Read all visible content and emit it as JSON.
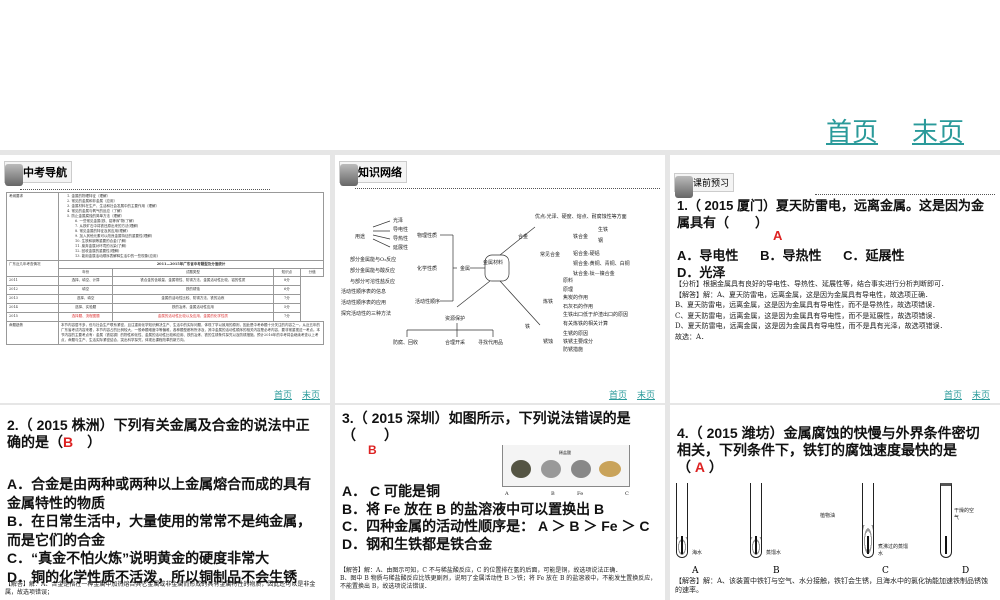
{
  "top_nav": {
    "first": "首页",
    "last": "末页"
  },
  "slide_nav": {
    "first": "首页",
    "last": "末页"
  },
  "slide1": {
    "header": "中考导航",
    "req_label": "考纲要求",
    "requirements": [
      "1. 金属的物理特征（理解）",
      "2. 常见的金属和非金属（应用）",
      "3. 金属材料在生产、生活和社会发展中的主要作用（理解）",
      "4. 常见的金属与氧气的反应（了解）",
      "5. 防止金属腐蚀的简单方法（理解）",
      "6. 一些常见金属(铁、铝等)矿物(了解)",
      "7. 从铁矿石中将铁还原出来的方法(理解)",
      "8. 常见金属的特征及其应用(理解)",
      "9. 加入其他元素可以改良金属特征的重要性(理解)",
      "10. 生铁和钢等重要的合金(了解)",
      "11. 废弃金属对环境的污染(了解)",
      "12. 回收金属的重要性(理解)",
      "13. 能用金属活动顺序表解释生活中的一些现象(应用)"
    ],
    "exam_label": "广东近几年考查情况",
    "table_title": "2011—2015年广东省中考题型及分值统计",
    "columns": [
      "年份",
      "试题类型",
      "知识点",
      "分值"
    ],
    "rows": [
      {
        "year": "2011",
        "type": "选择、填空、计算",
        "point": "铁合金的含碳量、金属物性、防锈方法、金属活动性比较、铝的性质",
        "score": "8分"
      },
      {
        "year": "2012",
        "type": "填空",
        "point": "铁的锈蚀",
        "score": "6分"
      },
      {
        "year": "2013",
        "type": "选择、填空",
        "point": "金属的活动性比较、防锈方法、铁的冶炼",
        "score": "7分"
      },
      {
        "year": "2014",
        "type": "选择、实验题",
        "point": "铁的冶炼、金属活动性应用",
        "score": "5分"
      },
      {
        "year": "2015",
        "type": "选择题、流程图题",
        "point": "金属的活动性比较以及应用、金属的化学性质",
        "score": "7分"
      }
    ],
    "trend_label": "命题趋势",
    "trend": "本节内容居不多，但与社会生产联系紧密，且注重用化学知识解决生产、生活中的实际问题，体现了学以致用的原则，因此是中考命题十分关注的内容之一。从近五年的广东省考试内容来看，本节内容占的比例较大，一般命题难度中等偏难，各种题型都有所涉及，其中金属的活动性顺序的相关内容是必考内容，要非常重视这一考点。本节内容的主要考点有：金属（铁铝铜）的物性和化性、金属的活动性比较和应用、铁的冶炼、铁的生锈条件探究以及防锈措施。预计2016年的中考将会继续考查以上考点，命题与生产、生活实际紧密结合，突出科学探究，体现出课程改革的新方向。"
  },
  "slide2": {
    "header": "知识网络",
    "center": "金属材料",
    "left": {
      "uses": "用途",
      "physical": [
        "光泽",
        "导电性",
        "导热性",
        "延展性"
      ],
      "physical_label": "物理性质",
      "chemical": [
        "部分金属能与O₂反应",
        "部分金属能与酸反应",
        "与部分可溶性盐反应"
      ],
      "chemical_label": "化学性质",
      "activity": [
        "活动性顺序表的信息",
        "活动性顺序表的应用",
        "探究活动性的三种方法"
      ],
      "activity_label": "活动性顺序",
      "metal": "金属"
    },
    "alloy": {
      "label": "合金",
      "advantage": "优点:光泽、硬度、熔点、耐腐蚀性等方面",
      "common": "常见合金",
      "iron_alloy": "铁合金",
      "iron_items": [
        "生铁",
        "钢"
      ],
      "others": [
        "铝合金:硬铝",
        "铜合金:黄铜、青铜、白铜",
        "钛合金:钛—镍合金"
      ]
    },
    "iron": {
      "label": "铁",
      "smelt": "炼铁",
      "smelt_items": [
        "原料",
        "原理",
        "焦炭的作用",
        "石灰石的作用",
        "生铁出口低于炉渣出口的原因",
        "有关炼铁的相关计算"
      ],
      "rust": "锈蚀",
      "rust_items": [
        "生锈的原因",
        "铁锈主要成分",
        "防锈措施"
      ]
    },
    "resource": {
      "label": "资源保护",
      "items": [
        "防腐、回收",
        "合理开采",
        "寻找代用品"
      ]
    }
  },
  "slide3": {
    "header": "课前预习",
    "question": "1.（ 2015 厦门）夏天防雷电，远离金属。这是因为金属具有（　　）",
    "answer": "A",
    "options": [
      "A．导电性",
      "B．导热性",
      "C．延展性",
      "D．光泽"
    ],
    "explanation": [
      "【分析】根据金属具有良好的导电性、导热性、延展性等，结合事实进行分析判断即可．",
      "【解答】解：A、夏天防雷电，远离金属，这是因为金属具有导电性，故选项正确．",
      "B、夏天防雷电，远离金属，这是因为金属具有导电性，而不是导热性，故选项错误．",
      "C、夏天防雷电，远离金属，这是因为金属具有导电性，而不是延展性，故选项错误．",
      "D、夏天防雷电，远离金属，这是因为金属具有导电性，而不是具有光泽，故选项错误．",
      "故选：A．"
    ]
  },
  "slide4": {
    "question_a": "2.（ 2015 株洲）下列有关金属及合金的说法中正确的是（",
    "answer": "B",
    "question_b": "　）",
    "options": [
      "A．合金是由两种或两种以上金属熔合而成的具有金属特性的物质",
      "B．在日常生活中，大量使用的常常不是纯金属，而是它们的合金",
      "C．“真金不怕火炼”说明黄金的硬度非常大",
      "D．铜的化学性质不活泼，所以铜制品不会生锈"
    ],
    "explanation": "【解答】解：A、合金是指在一种金属中加热熔合其它金属或非金属而形成的具有金属特性的物质，因此还可以是非金属，故选项错误；"
  },
  "slide5": {
    "question": "3.（ 2015 深圳）如图所示，下列说法错误的是（　　）",
    "answer": "B",
    "figure_labels": [
      "A",
      "B",
      "Fe",
      "C"
    ],
    "figure_caption": "稀盐酸",
    "options": [
      "A． C 可能是铜",
      "B．将 Fe 放在 B 的盐溶液中可以置换出 B",
      "C．四种金属的活动性顺序是： A ＞ B ＞ Fe ＞ C",
      "D．钢和生铁都是铁合金"
    ],
    "explanation": [
      "【解答】解：A、由图示可知，C 不与稀盐酸反应，C 的位置排在氢的后面，可能是铜，故选项说法正确．",
      "B、图中 B 物质与稀盐酸反应比铁更剧烈，说明了金属活动性 B ＞铁；将 Fe 放在 B 的盐溶液中，不能发生置换反应，不能置换出 B，故选项说法错误．"
    ]
  },
  "slide6": {
    "question": "4.（ 2015 潍坊）金属腐蚀的快慢与外界条件密切相关，下列条件下，铁钉的腐蚀速度最快的是（",
    "answer": "A",
    "question_end": "）",
    "tubes": [
      {
        "label": "A",
        "note": "海水"
      },
      {
        "label": "B",
        "note": "蒸馏水"
      },
      {
        "label": "C",
        "note": "煮沸过的蒸馏水",
        "note2": "植物油"
      },
      {
        "label": "D",
        "note": "干燥的空气"
      }
    ],
    "explanation": "【解答】解：A、该装置中铁钉与空气、水分接触，铁钉会生锈，且海水中的氯化钠能加速铁制品锈蚀的速率。"
  }
}
